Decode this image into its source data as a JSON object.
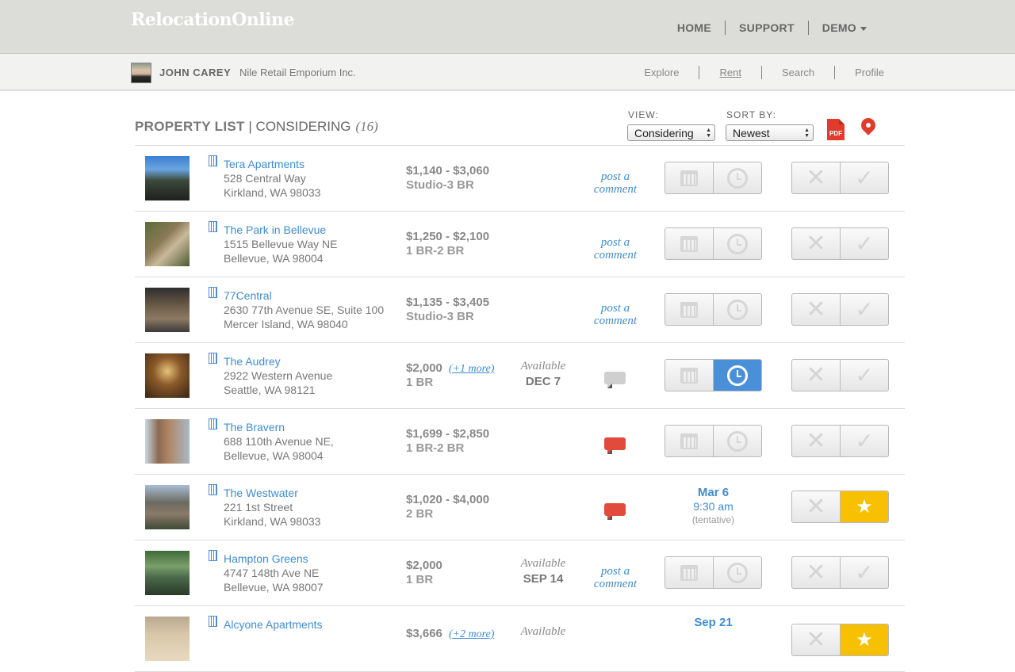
{
  "app": {
    "logo": "RelocationOnline"
  },
  "topnav": {
    "home": "HOME",
    "support": "SUPPORT",
    "demo": "DEMO"
  },
  "user": {
    "name": "JOHN CAREY",
    "company": "Nile Retail Emporium Inc."
  },
  "subnav": {
    "explore": "Explore",
    "rent": "Rent",
    "search": "Search",
    "profile": "Profile"
  },
  "list": {
    "title": "PROPERTY LIST",
    "sep": " | ",
    "filter": "CONSIDERING",
    "count": "(16)",
    "view_label": "VIEW:",
    "view_value": "Considering",
    "sort_label": "SORT BY:",
    "sort_value": "Newest",
    "pdf_label": "PDF"
  },
  "common": {
    "post_comment_1": "post a",
    "post_comment_2": "comment",
    "available": "Available"
  },
  "properties": [
    {
      "name": "Tera Apartments",
      "addr1": "528 Central Way",
      "addr2": "Kirkland, WA 98033",
      "price": "$1,140 - $3,060",
      "br": "Studio-3 BR"
    },
    {
      "name": "The Park in Bellevue",
      "addr1": "1515 Bellevue Way NE",
      "addr2": "Bellevue, WA 98004",
      "price": "$1,250 - $2,100",
      "br": "1 BR-2 BR"
    },
    {
      "name": "77Central",
      "addr1": "2630 77th Avenue SE, Suite 100",
      "addr2": "Mercer Island, WA 98040",
      "price": "$1,135 - $3,405",
      "br": "Studio-3 BR"
    },
    {
      "name": "The Audrey",
      "addr1": "2922 Western Avenue",
      "addr2": "Seattle, WA 98121",
      "price": "$2,000",
      "more": "(+1 more)",
      "br": "1 BR",
      "available": "DEC 7"
    },
    {
      "name": "The Bravern",
      "addr1": "688 110th Avenue NE,",
      "addr2": "Bellevue, WA 98004",
      "price": "$1,699 - $2,850",
      "br": "1 BR-2 BR"
    },
    {
      "name": "The Westwater",
      "addr1": "221 1st Street",
      "addr2": "Kirkland, WA 98033",
      "price": "$1,020 - $4,000",
      "br": "2 BR",
      "appt_date": "Mar 6",
      "appt_time": "9:30 am",
      "appt_note": "(tentative)"
    },
    {
      "name": "Hampton Greens",
      "addr1": "4747 148th Ave NE",
      "addr2": "Bellevue, WA 98007",
      "price": "$2,000",
      "br": "1 BR",
      "available": "SEP 14"
    },
    {
      "name": "Alcyone Apartments",
      "addr1": "",
      "addr2": "",
      "price": "$3,666",
      "more": "(+2 more)",
      "br": "",
      "available": "",
      "appt_date": "Sep 21"
    }
  ]
}
